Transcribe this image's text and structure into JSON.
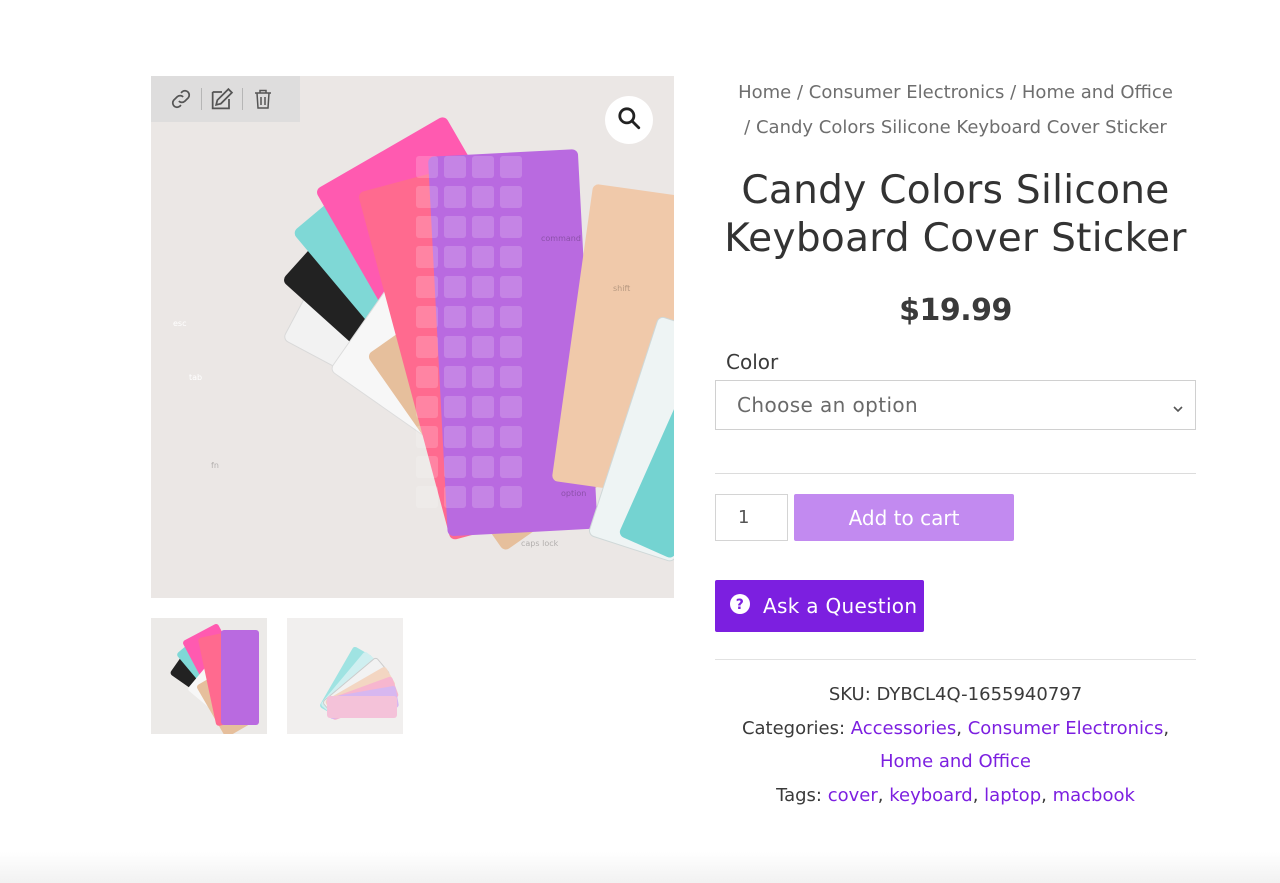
{
  "admin_toolbar": {
    "icons": [
      "link-icon",
      "edit-icon",
      "trash-icon"
    ]
  },
  "gallery": {
    "zoom_icon": "magnifier-icon",
    "keycap_text": [
      "esc",
      "tab",
      "shift",
      "fn",
      "command",
      "caps lock",
      "option"
    ],
    "thumbnails": [
      "thumbnail-1",
      "thumbnail-2"
    ]
  },
  "breadcrumb": {
    "items": [
      "Home",
      "Consumer Electronics",
      "Home and Office",
      "Candy Colors Silicone Keyboard Cover Sticker"
    ],
    "separator": " / "
  },
  "product": {
    "title": "Candy Colors Silicone Keyboard Cover Sticker",
    "price": "$19.99",
    "color_label": "Color",
    "color_select": "Choose an option",
    "quantity": "1",
    "add_to_cart": "Add to cart",
    "ask_question": "Ask a Question"
  },
  "meta": {
    "sku_label": "SKU:",
    "sku": "DYBCL4Q-1655940797",
    "categories_label": "Categories:",
    "categories": [
      "Accessories",
      "Consumer Electronics",
      "Home and Office"
    ],
    "tags_label": "Tags:",
    "tags": [
      "cover",
      "keyboard",
      "laptop",
      "macbook"
    ]
  },
  "colors": {
    "accent": "#7c1fe0",
    "add_to_cart_bg": "#c28af0",
    "link": "#7c1fe0"
  }
}
